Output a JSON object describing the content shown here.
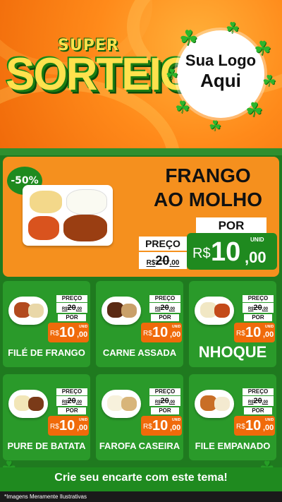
{
  "header": {
    "logo_super": "SUPER",
    "logo_main": "SORTEIO",
    "logo_placeholder_line1": "Sua Logo",
    "logo_placeholder_line2": "Aqui"
  },
  "featured": {
    "badge": "-50%",
    "title_line1": "FRANGO",
    "title_line2": "AO MOLHO",
    "preco_label": "PREÇO",
    "old_currency": "R$",
    "old_int": "20",
    "old_dec": ",00",
    "por_label": "POR",
    "new_currency": "R$",
    "new_int": "10",
    "new_dec": ",00",
    "unid": "UNID"
  },
  "products": [
    {
      "name": "FILÉ DE FRANGO",
      "preco_label": "PREÇO",
      "old_currency": "R$",
      "old_int": "20",
      "old_dec": ",00",
      "por_label": "POR",
      "new_currency": "R$",
      "new_int": "10",
      "new_dec": ",00",
      "unid": "UNID"
    },
    {
      "name": "CARNE ASSADA",
      "preco_label": "PREÇO",
      "old_currency": "R$",
      "old_int": "20",
      "old_dec": ",00",
      "por_label": "POR",
      "new_currency": "R$",
      "new_int": "10",
      "new_dec": ",00",
      "unid": "UNID"
    },
    {
      "name": "NHOQUE",
      "preco_label": "PREÇO",
      "old_currency": "R$",
      "old_int": "20",
      "old_dec": ",00",
      "por_label": "POR",
      "new_currency": "R$",
      "new_int": "10",
      "new_dec": ",00",
      "unid": "UNID"
    },
    {
      "name": "PURE DE BATATA",
      "preco_label": "PREÇO",
      "old_currency": "R$",
      "old_int": "20",
      "old_dec": ",00",
      "por_label": "POR",
      "new_currency": "R$",
      "new_int": "10",
      "new_dec": ",00",
      "unid": "UNID"
    },
    {
      "name": "FAROFA CASEIRA",
      "preco_label": "PREÇO",
      "old_currency": "R$",
      "old_int": "20",
      "old_dec": ",00",
      "por_label": "POR",
      "new_currency": "R$",
      "new_int": "10",
      "new_dec": ",00",
      "unid": "UNID"
    },
    {
      "name": "FILE EMPANADO",
      "preco_label": "PREÇO",
      "old_currency": "R$",
      "old_int": "20",
      "old_dec": ",00",
      "por_label": "POR",
      "new_currency": "R$",
      "new_int": "10",
      "new_dec": ",00",
      "unid": "UNID"
    }
  ],
  "footer": {
    "cta": "Crie seu encarte com este tema!"
  },
  "disclaimer": "*Imagens Meramente Ilustrativas",
  "colors": {
    "orange": "#f5901e",
    "green": "#1f8a1f",
    "price_orange": "#f06a0a",
    "yellow": "#ffe14d"
  },
  "icons": [
    "clover-icon"
  ]
}
